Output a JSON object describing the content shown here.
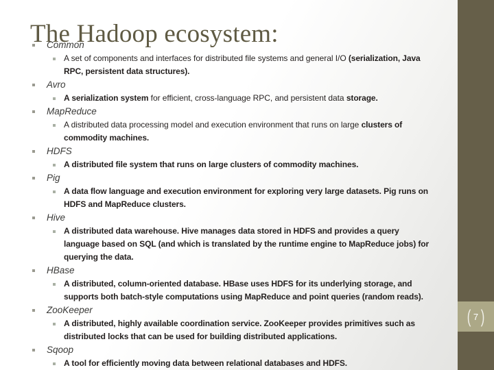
{
  "slide": {
    "title": "The Hadoop ecosystem:",
    "page_number": "7",
    "bracket_left": "(",
    "bracket_right": ")",
    "colors": {
      "title": "#5f5a43",
      "bar_dark_olive": "#665f49",
      "bar_light_olive": "#aca887",
      "body_text": "#231f1e",
      "bullet_level1": "#9a9a90",
      "bullet_level2": "#a9b0a4"
    }
  },
  "outline": [
    {
      "term": "Common",
      "desc_light": "A set of components and interfaces for distributed file systems and general I/O ",
      "desc_heavy": "(serialization, Java RPC, persistent data structures)."
    },
    {
      "term": "Avro",
      "desc_light": "A serialization system",
      "desc_heavy": "",
      "desc_mixed": true,
      "desc_parts": [
        {
          "text": "A serialization system ",
          "weight": "heavy"
        },
        {
          "text": "for efficient, cross-language RPC, and persistent data ",
          "weight": "light"
        },
        {
          "text": "storage.",
          "weight": "heavy"
        }
      ]
    },
    {
      "term": "MapReduce",
      "desc_parts": [
        {
          "text": "A distributed data processing model and execution environment that runs on large ",
          "weight": "light"
        },
        {
          "text": "clusters of commodity machines.",
          "weight": "heavy"
        }
      ]
    },
    {
      "term": "HDFS",
      "desc_parts": [
        {
          "text": "A distributed file system that runs on large clusters of commodity machines.",
          "weight": "heavy"
        }
      ]
    },
    {
      "term": "Pig",
      "desc_parts": [
        {
          "text": "A data flow language and execution environment for exploring very large datasets. Pig runs on HDFS and MapReduce clusters.",
          "weight": "heavy"
        }
      ]
    },
    {
      "term": "Hive",
      "desc_parts": [
        {
          "text": "A distributed data warehouse. Hive manages data stored in HDFS and provides a query language based on SQL (and which is translated by the runtime engine to MapReduce jobs) for querying the data.",
          "weight": "heavy"
        }
      ]
    },
    {
      "term": "HBase",
      "desc_parts": [
        {
          "text": "A distributed, column-oriented database. HBase uses HDFS for its underlying storage, and supports both batch-style computations using MapReduce and point queries (random reads).",
          "weight": "heavy"
        }
      ]
    },
    {
      "term": "ZooKeeper",
      "desc_parts": [
        {
          "text": "A distributed, highly available coordination service. ZooKeeper provides primitives such as distributed locks that can be used for building distributed applications.",
          "weight": "heavy"
        }
      ]
    },
    {
      "term": "Sqoop",
      "desc_parts": [
        {
          "text": "A tool for efficiently moving data between relational databases and HDFS.",
          "weight": "heavy"
        }
      ]
    }
  ]
}
